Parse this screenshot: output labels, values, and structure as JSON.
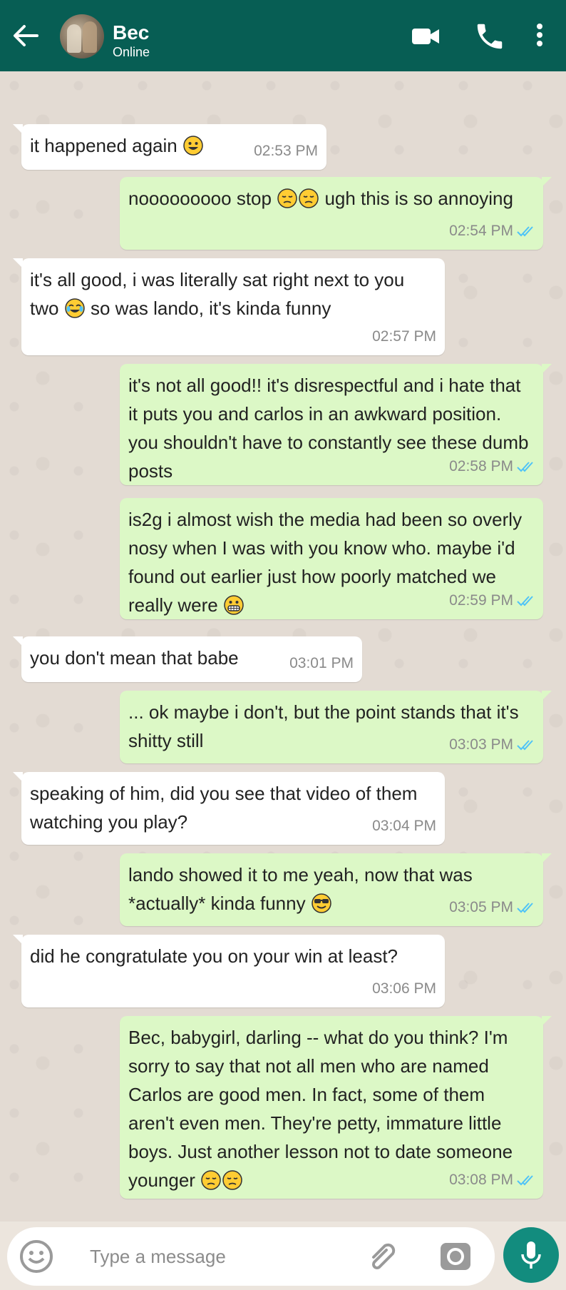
{
  "header": {
    "contact_name": "Bec",
    "status": "Online"
  },
  "icons": {
    "back": "arrow-left-icon",
    "video": "video-camera-icon",
    "call": "phone-icon",
    "menu": "more-vertical-icon",
    "emoji_picker": "smiley-icon",
    "attach": "paperclip-icon",
    "camera": "camera-icon",
    "mic": "microphone-icon"
  },
  "colors": {
    "header": "#075e54",
    "outgoing_bubble": "#dcf8c6",
    "incoming_bubble": "#ffffff",
    "read_ticks": "#4fc3f7",
    "mic_button": "#128c7e"
  },
  "messages": [
    {
      "dir": "in",
      "text": "it happened again",
      "emoji": [
        "grinning"
      ],
      "time": "02:53 PM"
    },
    {
      "dir": "out",
      "text_before": "nooooooooo stop",
      "emoji": [
        "pensive",
        "pensive"
      ],
      "text_after": "ugh this is so annoying",
      "time": "02:54 PM",
      "read": true
    },
    {
      "dir": "in",
      "text_before": "it's all good, i was literally sat right next to you two",
      "emoji": [
        "joy"
      ],
      "text_after": "so was lando, it's kinda funny",
      "time": "02:57 PM"
    },
    {
      "dir": "out",
      "text": "it's not all good!! it's disrespectful and i hate that it puts you and carlos in an awkward position. you shouldn't have to constantly see these dumb posts",
      "time": "02:58 PM",
      "read": true
    },
    {
      "dir": "out",
      "text": "is2g i almost wish the media had been so overly nosy when I was with you know who. maybe i'd found out earlier just how poorly matched we really were",
      "emoji": [
        "grimacing"
      ],
      "time": "02:59 PM",
      "read": true
    },
    {
      "dir": "in",
      "text": "you don't mean that babe",
      "time": "03:01 PM"
    },
    {
      "dir": "out",
      "text": "... ok maybe i don't, but the point stands that it's shitty still",
      "time": "03:03 PM",
      "read": true
    },
    {
      "dir": "in",
      "text": "speaking of him, did you see that video of them watching you play?",
      "time": "03:04 PM"
    },
    {
      "dir": "out",
      "text": "lando showed it to me yeah, now that was *actually* kinda funny",
      "emoji": [
        "sunglasses"
      ],
      "time": "03:05 PM",
      "read": true
    },
    {
      "dir": "in",
      "text": "did he congratulate you on your win at least?",
      "time": "03:06 PM"
    },
    {
      "dir": "out",
      "text": "Bec, babygirl, darling -- what do you think? I'm sorry to say that not all men who are named Carlos are good men. In fact, some of them aren't even men. They're petty, immature little boys. Just another lesson not to date someone younger",
      "emoji": [
        "pensive",
        "pensive"
      ],
      "time": "03:08 PM",
      "read": true
    }
  ],
  "composer": {
    "placeholder": "Type a message"
  }
}
